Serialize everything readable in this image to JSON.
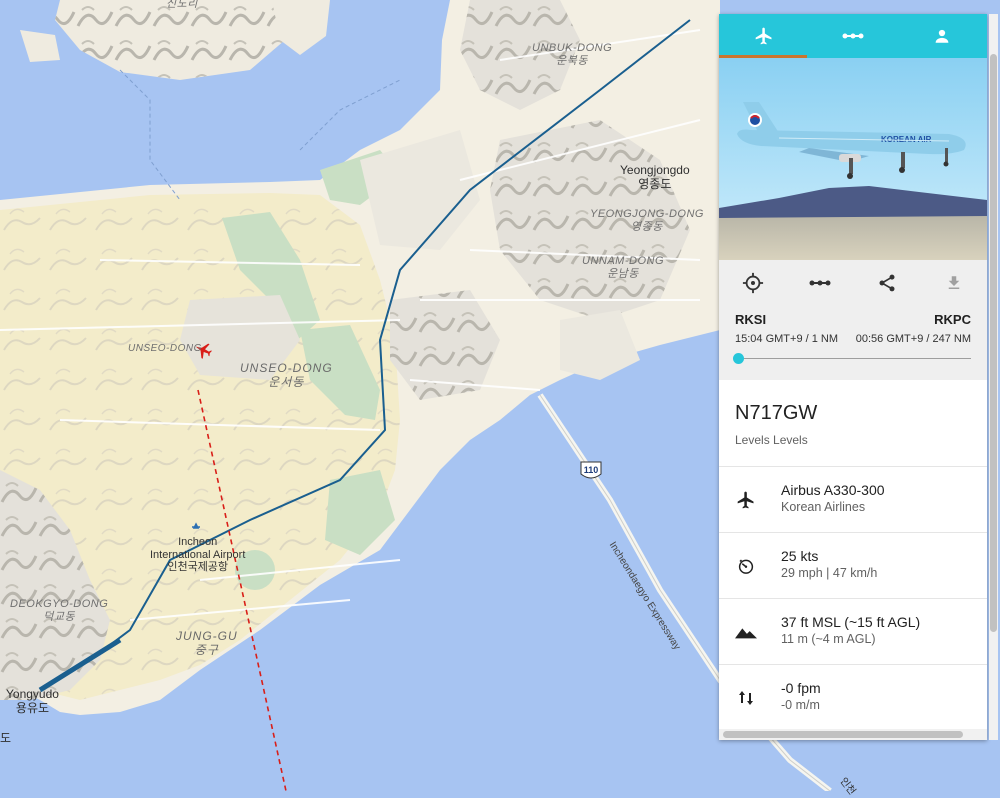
{
  "colors": {
    "accent": "#26c6da",
    "tab_indicator": "#c9752e",
    "flight_path": "#d91e18",
    "water": "#a7c4f2"
  },
  "map": {
    "labels": {
      "sindo_partial": "신도리",
      "unbuk_dong": "UNBUK-DONG",
      "unbuk_dong_ko": "운북동",
      "yeongjongdo": "Yeongjongdo",
      "yeongjongdo_ko": "영종도",
      "yeongjong_dong": "YEONGJONG-DONG",
      "yeongjong_dong_ko": "영종동",
      "unnam_dong": "UNNAM-DONG",
      "unnam_dong_ko": "운남동",
      "unseo_dong_small": "UNSEO-DONG",
      "unseo_dong": "UNSEO-DONG",
      "unseo_dong_ko": "운서동",
      "airport": "Incheon",
      "airport_line2": "International Airport",
      "airport_ko": "인천국제공항",
      "deokgyo_dong": "DEOKGYO-DONG",
      "deokgyo_dong_ko": "덕교동",
      "jung_gu": "JUNG-GU",
      "jung_gu_ko": "중구",
      "yongyudo": "Yongyudo",
      "yongyudo_ko": "용유도",
      "edge_partial": "도",
      "bottom_partial": "인천",
      "expressway": "Incheondaegyo Expressway",
      "route_shield": "110"
    },
    "aircraft_icon": "red-airplane-icon"
  },
  "panel": {
    "tabs": [
      {
        "name": "tab-aircraft",
        "icon": "airplane-icon"
      },
      {
        "name": "tab-route",
        "icon": "route-icon"
      },
      {
        "name": "tab-pilot",
        "icon": "person-icon"
      }
    ],
    "photo": {
      "livery_text": "KOREAN AIR"
    },
    "actions": [
      {
        "name": "center-button",
        "icon": "crosshair-icon"
      },
      {
        "name": "track-button",
        "icon": "route-icon"
      },
      {
        "name": "share-button",
        "icon": "share-icon"
      },
      {
        "name": "download-button",
        "icon": "download-icon",
        "disabled": true
      }
    ],
    "route": {
      "origin": "RKSI",
      "destination": "RKPC",
      "origin_time": "15:04 GMT+9 / 1 NM",
      "destination_time": "00:56 GMT+9 / 247 NM",
      "progress_fraction": 0.004
    },
    "registration": "N717GW",
    "subtitle": "Levels Levels",
    "rows": [
      {
        "name": "aircraft-type",
        "icon": "airplane-icon",
        "main": "Airbus A330-300",
        "sub": "Korean Airlines"
      },
      {
        "name": "speed",
        "icon": "speedometer-icon",
        "main": "25 kts",
        "sub": "29 mph | 47 km/h"
      },
      {
        "name": "altitude",
        "icon": "mountain-icon",
        "main": "37 ft MSL (~15 ft AGL)",
        "sub": "11 m (~4 m AGL)"
      },
      {
        "name": "vertical-speed",
        "icon": "vertical-arrows-icon",
        "main": "-0 fpm",
        "sub": "-0 m/m"
      }
    ]
  }
}
